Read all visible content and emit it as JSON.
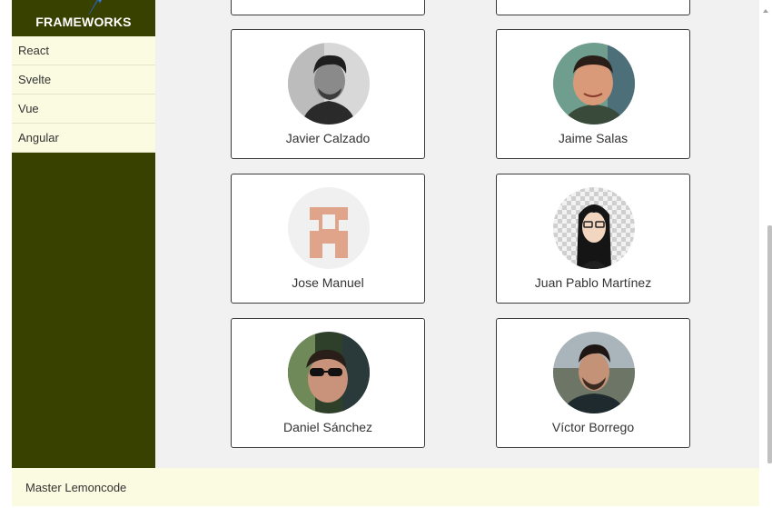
{
  "sidebar": {
    "title": "FRAMEWORKS",
    "items": [
      {
        "label": "React"
      },
      {
        "label": "Svelte"
      },
      {
        "label": "Vue"
      },
      {
        "label": "Angular"
      }
    ]
  },
  "members": [
    {
      "name": "Javier Calzado"
    },
    {
      "name": "Jaime Salas"
    },
    {
      "name": "Jose Manuel"
    },
    {
      "name": "Juan Pablo Martínez"
    },
    {
      "name": "Daniel Sánchez"
    },
    {
      "name": "Víctor Borrego"
    }
  ],
  "footer": {
    "text": "Master Lemoncode"
  },
  "colors": {
    "sidebar_bg": "#394100",
    "menu_bg": "#fbfbe1",
    "content_bg": "#f1f1f1",
    "card_border": "#3a3a3a"
  }
}
